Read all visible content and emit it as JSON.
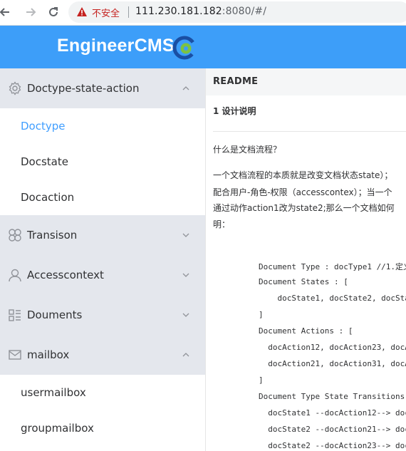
{
  "browser": {
    "security_label": "不安全",
    "url_host": "111.230.181.182",
    "url_rest": ":8080/#/"
  },
  "header": {
    "brand": "EngineerCMS"
  },
  "sidebar": {
    "groups": [
      {
        "label": "Doctype-state-action",
        "icon": "gear-icon",
        "expanded": true,
        "items": [
          {
            "label": "Doctype",
            "active": true
          },
          {
            "label": "Docstate",
            "active": false
          },
          {
            "label": "Docaction",
            "active": false
          }
        ]
      },
      {
        "label": "Transison",
        "icon": "circles-icon",
        "expanded": false
      },
      {
        "label": "Accesscontext",
        "icon": "user-icon",
        "expanded": false
      },
      {
        "label": "Douments",
        "icon": "document-list-icon",
        "expanded": false
      },
      {
        "label": "mailbox",
        "icon": "mail-icon",
        "expanded": true,
        "items": [
          {
            "label": "usermailbox",
            "active": false
          },
          {
            "label": "groupmailbox",
            "active": false
          }
        ]
      }
    ]
  },
  "main": {
    "readme_label": "README",
    "heading": "1 设计说明",
    "paragraphs": [
      "什么是文档流程？",
      "一个文档流程的本质就是改变文档状态state）；",
      "配合用户-角色-权限（accesscontex）；当一个",
      "通过动作action1改为state2;那么一个文档如何",
      "明："
    ],
    "code_lines": [
      "Document Type : docType1 //1.定义",
      "Document States : [",
      "    docState1, docState2, docSta",
      "]",
      "Document Actions : [",
      "  docAction12, docAction23, docAc",
      "  docAction21, docAction31, docAc",
      "]",
      "Document Type State Transitions",
      "  docState1 --docAction12--> doc",
      "  docState2 --docAction21--> doc",
      "  docState2 --docAction23--> doc"
    ]
  },
  "colors": {
    "header_bg": "#3d9ef9",
    "submenu_title_bg": "#e4e7ed",
    "active_item": "#409eff",
    "insecure_red": "#c5221f"
  }
}
